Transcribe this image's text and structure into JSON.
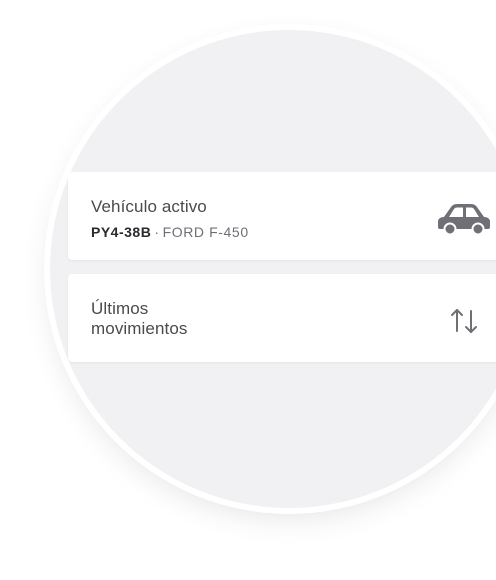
{
  "vehicle_card": {
    "title": "Vehículo activo",
    "plate": "PY4-38B",
    "separator": "·",
    "model": "FORD F-450",
    "icon": "car-icon"
  },
  "movements_card": {
    "title_line1": "Últimos",
    "title_line2": "movimientos",
    "icon": "up-down-arrows-icon"
  },
  "colors": {
    "lens_background": "#f1f1f3",
    "card_background": "#ffffff",
    "icon_color": "#6f6f75"
  }
}
